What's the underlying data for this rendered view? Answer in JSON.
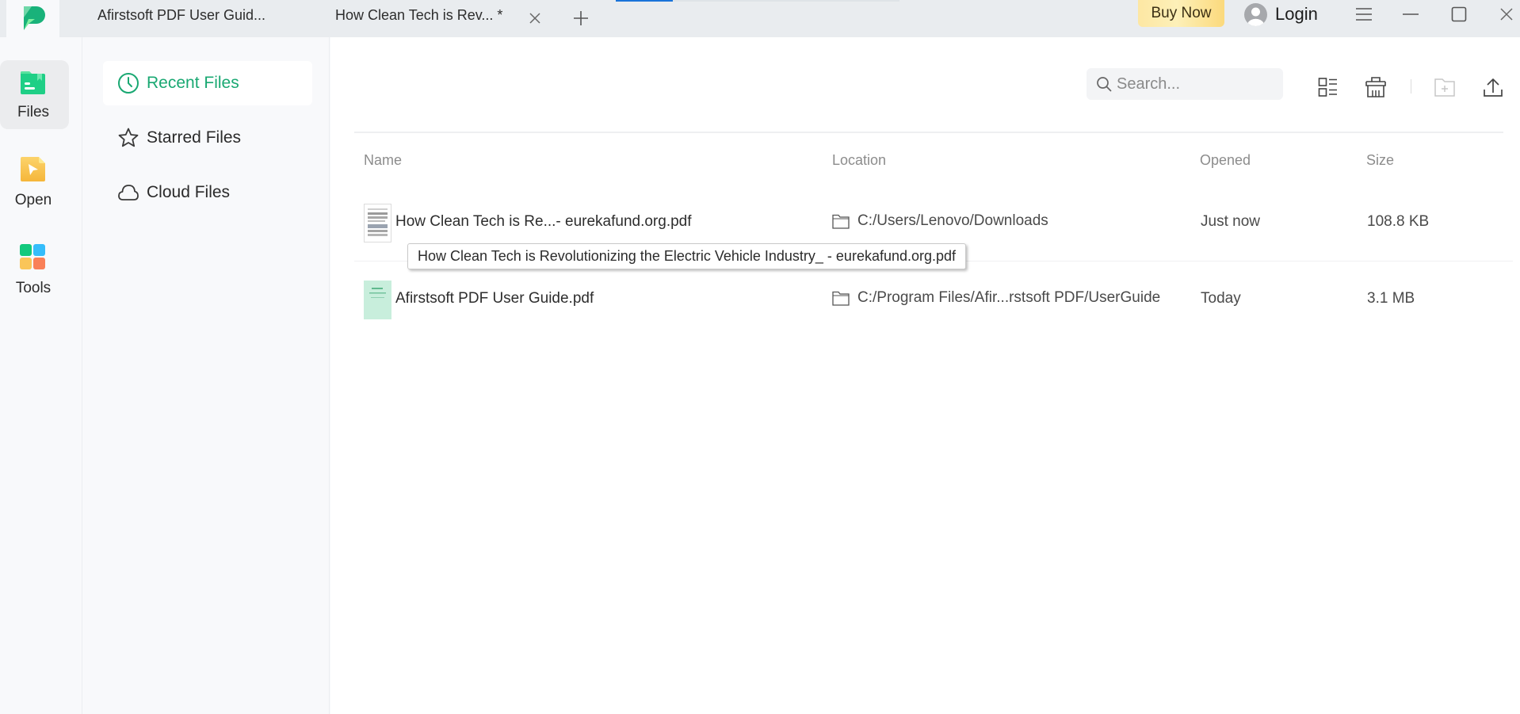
{
  "titlebar": {
    "tabs": [
      {
        "label": "Afirstsoft PDF User Guid..."
      },
      {
        "label": "How Clean Tech is Rev... *"
      }
    ],
    "buy_now_label": "Buy Now",
    "login_label": "Login",
    "icons": {
      "logo": "app-logo-icon",
      "close_tab": "close-icon",
      "new_tab": "plus-icon",
      "avatar": "user-avatar-icon",
      "menu": "hamburger-menu-icon",
      "minimize": "minimize-icon",
      "maximize": "maximize-icon",
      "close": "close-icon"
    }
  },
  "rail": {
    "items": [
      {
        "label": "Files",
        "icon": "folder-icon",
        "active": true
      },
      {
        "label": "Open",
        "icon": "open-file-icon",
        "active": false
      },
      {
        "label": "Tools",
        "icon": "tools-grid-icon",
        "active": false
      }
    ]
  },
  "sidebar": {
    "items": [
      {
        "label": "Recent Files",
        "icon": "clock-icon",
        "active": true
      },
      {
        "label": "Starred Files",
        "icon": "star-icon",
        "active": false
      },
      {
        "label": "Cloud Files",
        "icon": "cloud-icon",
        "active": false
      }
    ]
  },
  "toolbar": {
    "search_placeholder": "Search...",
    "search_value": "",
    "buttons": [
      {
        "icon": "list-view-icon"
      },
      {
        "icon": "trash-icon"
      },
      {
        "icon": "new-folder-icon",
        "disabled": true
      },
      {
        "icon": "upload-icon"
      }
    ]
  },
  "table": {
    "columns": [
      "Name",
      "Location",
      "Opened",
      "Size"
    ],
    "rows": [
      {
        "name": "How Clean Tech is Re...- eurekafund.org.pdf",
        "location": "C:/Users/Lenovo/Downloads",
        "opened": "Just now",
        "size": "108.8 KB"
      },
      {
        "name": "Afirstsoft PDF User Guide.pdf",
        "location": "C:/Program Files/Afir...rstsoft PDF/UserGuide",
        "opened": "Today",
        "size": "3.1 MB"
      }
    ]
  },
  "tooltip": {
    "text": "How Clean Tech is Revolutionizing the Electric Vehicle Industry_ - eurekafund.org.pdf"
  },
  "colors": {
    "accent": "#19a872",
    "titlebar_bg": "#e9ecef",
    "scroll_indicator": "#1a73d9",
    "buy_now_gradient_start": "#fde7a3",
    "buy_now_gradient_end": "#fbd97c"
  }
}
